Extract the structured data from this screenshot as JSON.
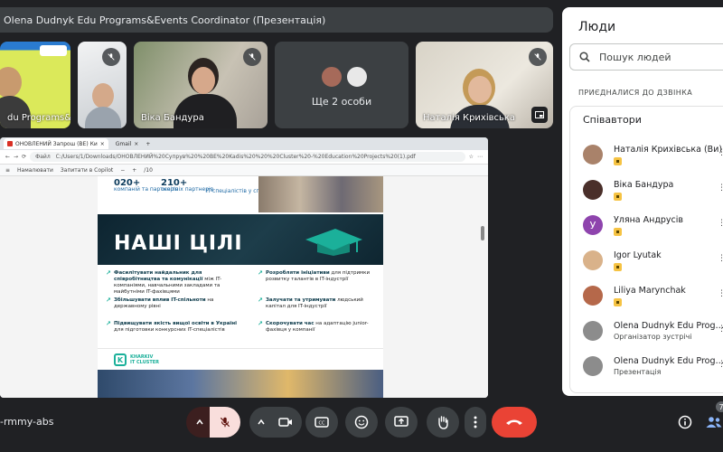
{
  "meeting": {
    "title": "Olena Dudnyk Edu Programs&Events Coordinator (Презентація)",
    "code": "-rmmy-abs"
  },
  "tiles": [
    {
      "name": "du Programs&"
    },
    {
      "name": ""
    },
    {
      "name": "Віка Бандура"
    },
    {
      "more_label": "Ще 2 особи"
    },
    {
      "name": "Наталія Крихівська"
    }
  ],
  "browser": {
    "tab_active": "ОНОВЛЕНИЙ Запрош (BE) Ки",
    "tab_2": "Gmail",
    "address": "C:/Users/1/Downloads/ОНОВЛЕНИЙ%20Супрув%20%20BE%20Kadis%20%20%20Cluster%20-%20Education%20Projects%20(1).pdf",
    "address_prefix": "Файл",
    "pdf_draw": "Намалювати",
    "pdf_ai": "Запитати в Copilot",
    "pdf_page": "/10"
  },
  "slide": {
    "stat1_num": "020+",
    "stat1_text": "компаній\nта партнерів",
    "stat2_num": "210+",
    "stat2_text": "освітніх\nпартнерів",
    "stat3_text": "IT-спеціалістів\nу спільноті",
    "goals_title": "НАШІ ЦІЛІ",
    "goals": [
      {
        "bold": "Фасилітувати найдальник для співробітництва та комунікації",
        "rest": " між IT-компаніями, навчальними закладами та майбутніми IT-фахівцями"
      },
      {
        "bold": "Розробляти ініціативи",
        "rest": " для підтримки розвитку талантів в IT-індустрії"
      },
      {
        "bold": "Збільшувати вплив IT-спільноти",
        "rest": " на державному рівні"
      },
      {
        "bold": "Залучати та утримувати",
        "rest": " людський капітал для IT-індустрії"
      },
      {
        "bold": "Підвищувати якість вищої освіти в Україні",
        "rest": " для підготовки конкурсних IT-спеціалістів"
      },
      {
        "bold": "Скорочувати час",
        "rest": " на адаптацію junior-фахівця у компанії"
      }
    ],
    "logo_letter": "K",
    "logo_text": "KHARKIV\nIT CLUSTER"
  },
  "controls": {
    "people_badge": "7"
  },
  "panel": {
    "title": "Люди",
    "search_placeholder": "Пошук людей",
    "section_label": "ПРИЄДНАЛИСЯ ДО ДЗВІНКА",
    "group_title": "Співавтори",
    "people": [
      {
        "name": "Наталія Крихівська (Ви)",
        "role": "",
        "avatar_color": "#a9826a",
        "initial": ""
      },
      {
        "name": "Віка Бандура",
        "role": "",
        "avatar_color": "#4a2f2a",
        "initial": ""
      },
      {
        "name": "Уляна Андрусів",
        "role": "",
        "avatar_color": "#8e44ad",
        "initial": "У"
      },
      {
        "name": "Igor Lyutak",
        "role": "",
        "avatar_color": "#d9b28a",
        "initial": ""
      },
      {
        "name": "Liliya Marynchak",
        "role": "",
        "avatar_color": "#b5684a",
        "initial": ""
      },
      {
        "name": "Olena Dudnyk Edu Prog…",
        "role": "Організатор зустрічі",
        "avatar_color": "#8c8c8c",
        "initial": ""
      },
      {
        "name": "Olena Dudnyk Edu Prog…",
        "role": "Презентація",
        "avatar_color": "#8c8c8c",
        "initial": ""
      }
    ]
  }
}
